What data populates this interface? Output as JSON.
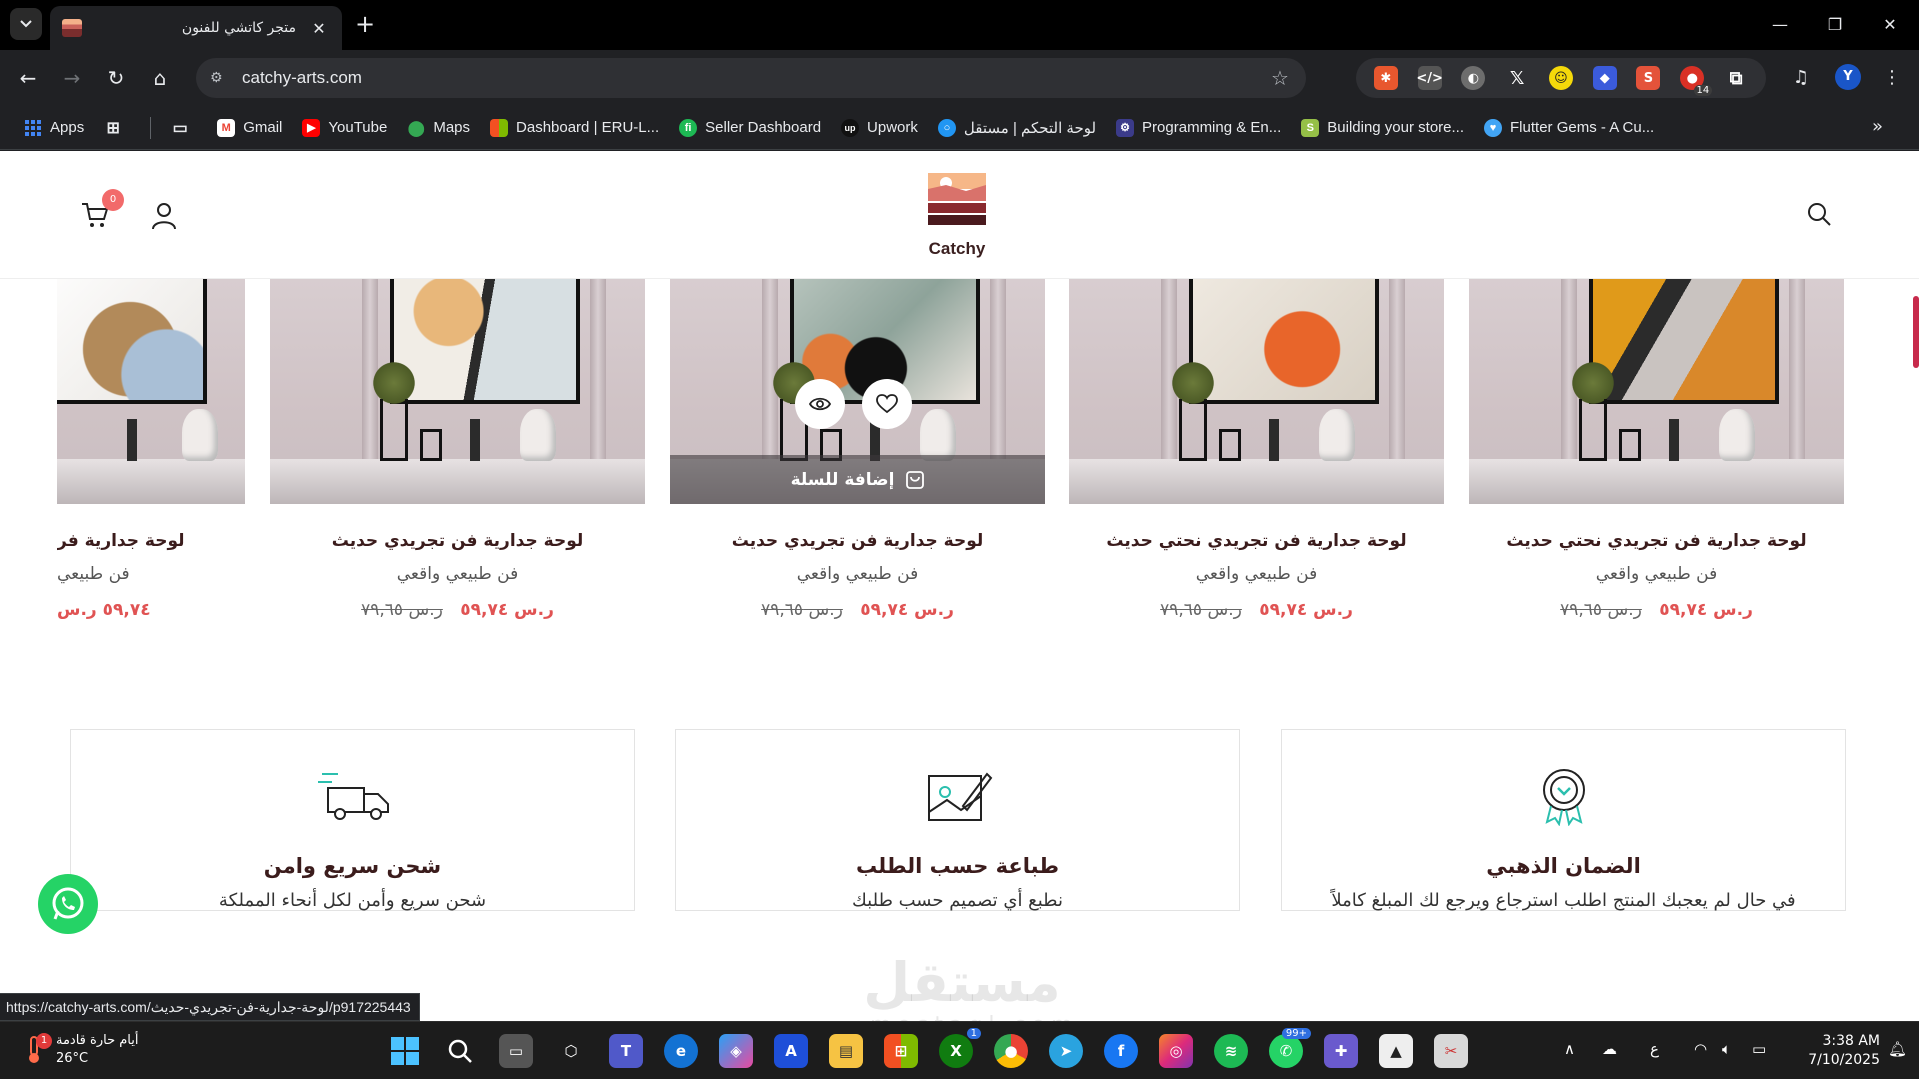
{
  "browser": {
    "tab_title": "متجر كاتشي للفنون",
    "url": "catchy-arts.com",
    "profile_initial": "Y",
    "extension_badge": "14",
    "bookmarks": [
      {
        "label": "Apps",
        "icon": "apps-grid-icon",
        "color": "#4285f4"
      },
      {
        "label": "Gmail",
        "icon": "gmail-icon",
        "color": "#ea4335"
      },
      {
        "label": "YouTube",
        "icon": "youtube-icon",
        "color": "#ff0000"
      },
      {
        "label": "Maps",
        "icon": "maps-icon",
        "color": "#34a853"
      },
      {
        "label": "Dashboard | ERU-L...",
        "icon": "microsoft-icon",
        "color": "#f25022"
      },
      {
        "label": "Seller Dashboard",
        "icon": "fi-icon",
        "color": "#1db954"
      },
      {
        "label": "Upwork",
        "icon": "upwork-icon",
        "color": "#111111"
      },
      {
        "label": "لوحة التحكم | مستقل",
        "icon": "mostaql-icon",
        "color": "#2196f3"
      },
      {
        "label": "Programming & En...",
        "icon": "programming-icon",
        "color": "#3b3b8a"
      },
      {
        "label": "Building your store...",
        "icon": "shopify-icon",
        "color": "#95bf47"
      },
      {
        "label": "Flutter Gems - A Cu...",
        "icon": "flutter-gems-icon",
        "color": "#42a5f5"
      }
    ]
  },
  "site": {
    "logo_text": "Catchy",
    "cart_count": "0",
    "accent": "#e05353",
    "title_color": "#3b1c1c"
  },
  "products": [
    {
      "title": "لوحة جدارية فن تجريدي نحتي حديث",
      "category": "فن طبيعي واقعي",
      "price_new": "٥٩,٧٤",
      "price_old": "٧٩,٦٥",
      "currency": "ر.س",
      "hover": false
    },
    {
      "title": "لوحة جدارية فن تجريدي نحتي حديث",
      "category": "فن طبيعي واقعي",
      "price_new": "٥٩,٧٤",
      "price_old": "٧٩,٦٥",
      "currency": "ر.س",
      "hover": false
    },
    {
      "title": "لوحة جدارية فن تجريدي حديث",
      "category": "فن طبيعي واقعي",
      "price_new": "٥٩,٧٤",
      "price_old": "٧٩,٦٥",
      "currency": "ر.س",
      "hover": true
    },
    {
      "title": "لوحة جدارية فن تجريدي حديث",
      "category": "فن طبيعي واقعي",
      "price_new": "٥٩,٧٤",
      "price_old": "٧٩,٦٥",
      "currency": "ر.س",
      "hover": false
    },
    {
      "title": "لوحة جدارية فر",
      "category": "فن طبيعي",
      "price_new": "٥٩,٧٤",
      "price_old": "",
      "currency": "ر.س",
      "hover": false
    }
  ],
  "hover_actions": {
    "add_to_cart": "إضافة للسلة"
  },
  "features": [
    {
      "title": "الضمان الذهبي",
      "desc": "في حال لم يعجبك المنتج اطلب استرجاع ويرجع لك المبلغ كاملاً",
      "icon": "medal-icon"
    },
    {
      "title": "طباعة حسب الطلب",
      "desc": "نطبع أي تصميم حسب طلبك",
      "icon": "canvas-pen-icon"
    },
    {
      "title": "شحن سريع وامن",
      "desc": "شحن سريع وأمن لكل أنحاء المملكة",
      "icon": "delivery-truck-icon"
    }
  ],
  "watermark": {
    "ar": "مستقل",
    "en": "mostaql.com"
  },
  "status_url": "https://catchy-arts.com/لوحة-جدارية-فن-تجريدي-حديث/p917225443",
  "taskbar": {
    "weather_line1": "أيام حارة قادمة",
    "weather_temp": "26°C",
    "weather_badge": "1",
    "lang": "ع",
    "time": "3:38 AM",
    "date": "7/10/2025",
    "teams_badge": "",
    "xbox_badge": "1",
    "whatsapp_badge": "99+"
  }
}
